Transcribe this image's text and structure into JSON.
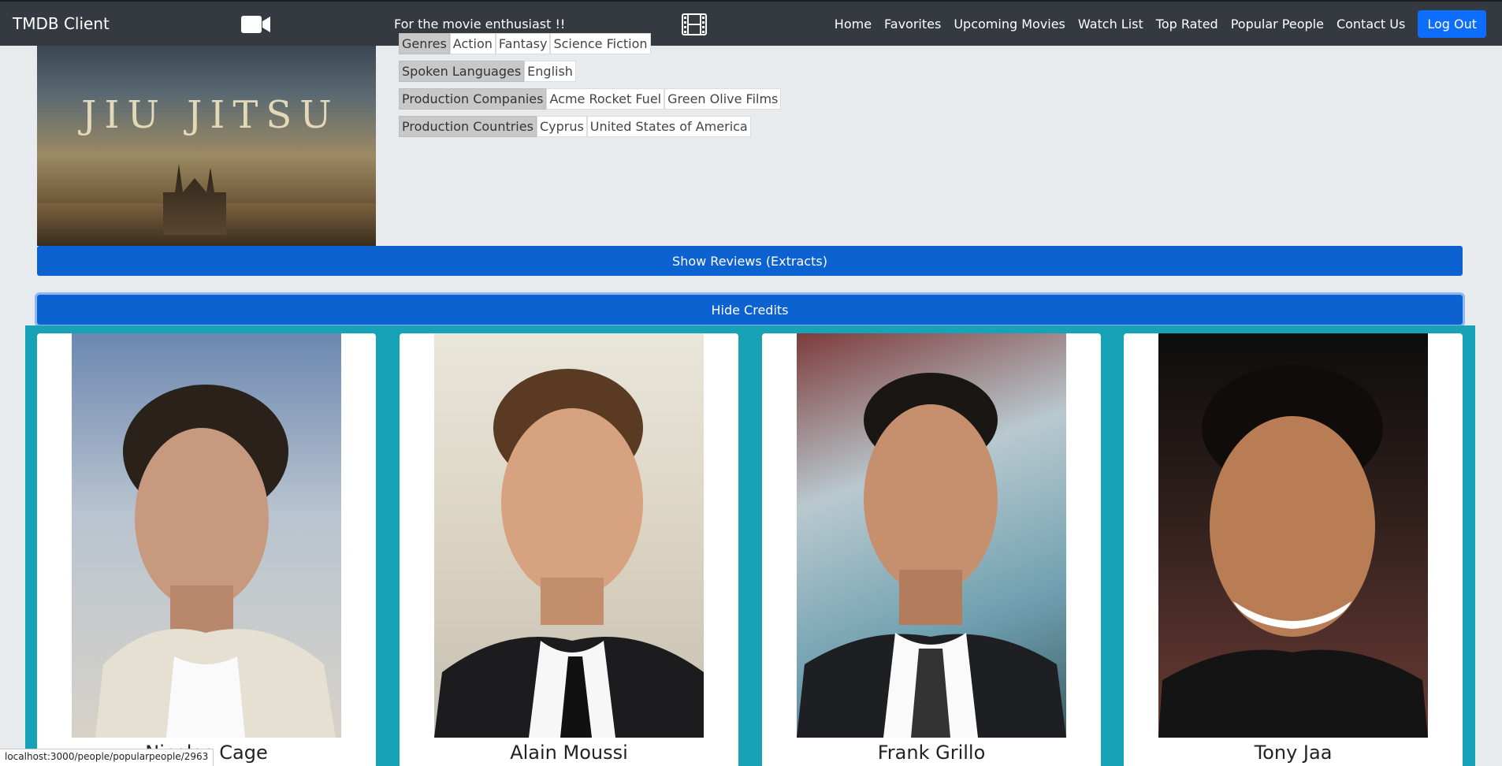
{
  "navbar": {
    "brand": "TMDB Client",
    "tagline": "For the movie enthusiast !!",
    "links": [
      "Home",
      "Favorites",
      "Upcoming Movies",
      "Watch List",
      "Top Rated",
      "Popular People",
      "Contact Us"
    ],
    "logout_label": "Log Out"
  },
  "movie": {
    "poster_title": "JIU JITSU",
    "details": {
      "genres": {
        "label": "Genres",
        "values": [
          "Action",
          "Fantasy",
          "Science Fiction"
        ]
      },
      "spoken_languages": {
        "label": "Spoken Languages",
        "values": [
          "English"
        ]
      },
      "production_companies": {
        "label": "Production Companies",
        "values": [
          "Acme Rocket Fuel",
          "Green Olive Films"
        ]
      },
      "production_countries": {
        "label": "Production Countries",
        "values": [
          "Cyprus",
          "United States of America"
        ]
      }
    }
  },
  "actions": {
    "show_reviews": "Show Reviews (Extracts)",
    "hide_credits": "Hide Credits"
  },
  "credits": [
    {
      "name": "Nicolas Cage"
    },
    {
      "name": "Alain Moussi"
    },
    {
      "name": "Frank Grillo"
    },
    {
      "name": "Tony Jaa"
    }
  ],
  "status_bar": {
    "url": "localhost:3000/people/popularpeople/2963"
  }
}
